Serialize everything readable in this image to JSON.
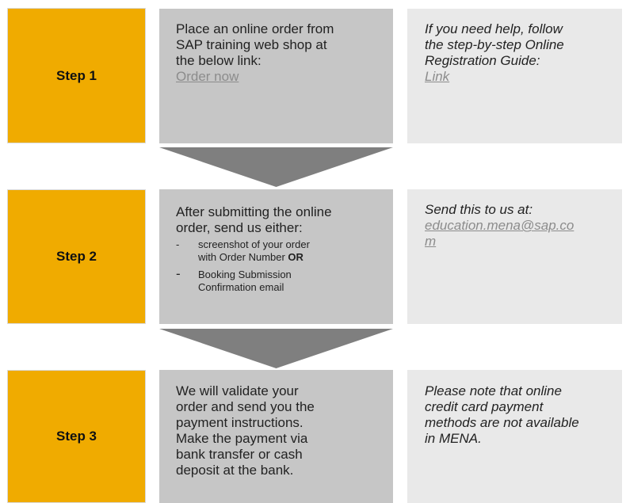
{
  "colors": {
    "step_box": "#f0ab00",
    "step_box_border": "#d9d9d9",
    "detail_box": "#c6c6c6",
    "note_box": "#e9e9e9",
    "arrow": "#7f7f7f",
    "link": "#8c8c8c"
  },
  "steps": [
    {
      "label": "Step 1",
      "detail": {
        "lines": [
          "Place an online order from",
          "SAP training web shop at",
          "the below link:"
        ],
        "link": "Order now"
      },
      "note": {
        "lines": [
          "If you need help, follow",
          "the step-by-step Online",
          "Registration Guide:"
        ],
        "link": "Link"
      }
    },
    {
      "label": "Step 2",
      "detail": {
        "lines": [
          "After submitting the online",
          "order, send us either:"
        ],
        "bullets": [
          {
            "dash": "-",
            "text_1": "screenshot of your order",
            "text_2": "with Order Number ",
            "bold": "OR"
          },
          {
            "dash": "-",
            "text_1": "Booking Submission",
            "text_2": "Confirmation email"
          }
        ]
      },
      "note": {
        "lines": [
          "Send this to us at:"
        ],
        "link_1": "education.mena@sap.co",
        "link_2": "m"
      }
    },
    {
      "label": "Step 3",
      "detail": {
        "lines": [
          "We will validate your",
          "order and send you the",
          "payment instructions.",
          "Make the payment via",
          "bank transfer or cash",
          "deposit at the bank."
        ]
      },
      "note": {
        "lines": [
          "Please note that online",
          "credit card payment",
          "methods are not available",
          "in MENA."
        ]
      }
    }
  ]
}
